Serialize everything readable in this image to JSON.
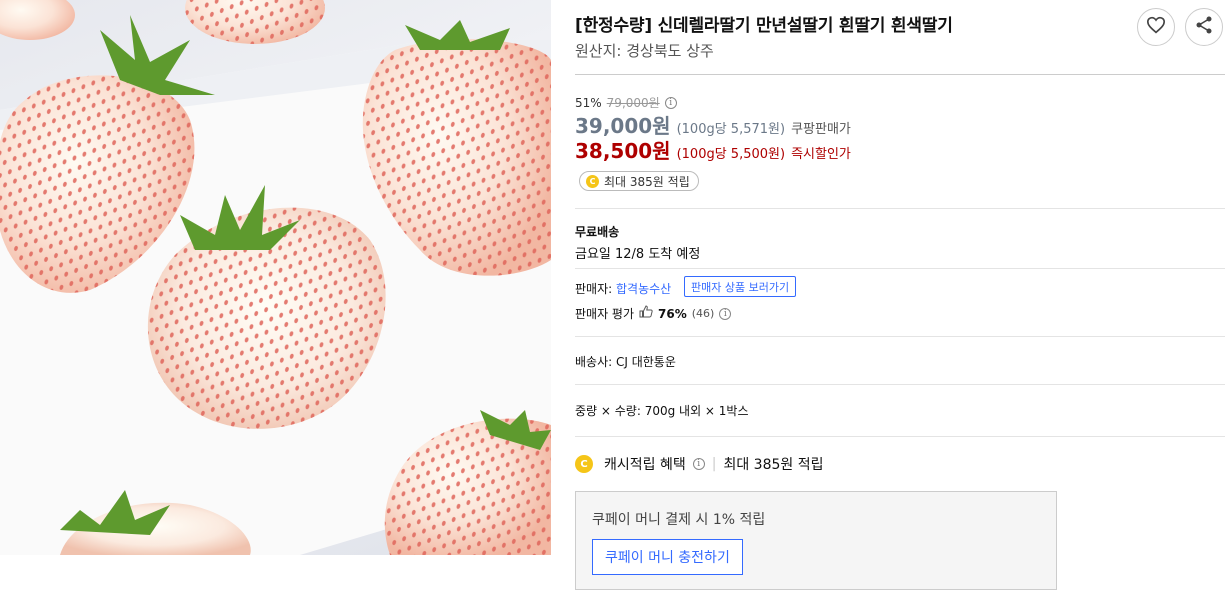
{
  "product": {
    "title": "[한정수량] 신데렐라딸기 만년설딸기 흰딸기 흰색딸기",
    "origin": "원산지: 경상북도 상주",
    "image_alt": "흰딸기"
  },
  "pricing": {
    "discount_rate": "51%",
    "original_price": "79,000원",
    "sale_price": "39,000원",
    "sale_unit": "(100g당 5,571원)",
    "sale_tag": "쿠팡판매가",
    "instant_price": "38,500원",
    "instant_unit": "(100g당 5,500원)",
    "instant_tag": "즉시할인가",
    "cash_pill": "최대 385원 적립"
  },
  "shipping": {
    "title": "무료배송",
    "arrival": "금요일 12/8 도착 예정"
  },
  "seller": {
    "label": "판매자:",
    "name": "합격농수산",
    "view_products": "판매자 상품 보러가기",
    "rating_label": "판매자 평가",
    "rating_percent": "76%",
    "rating_count": "(46)"
  },
  "carrier": "배송사: CJ 대한통운",
  "spec": "중량 × 수량: 700g 내외 × 1박스",
  "cash": {
    "label": "캐시적립 혜택",
    "value": "최대 385원 적립"
  },
  "coupay": {
    "message": "쿠페이 머니 결제 시 1% 적립",
    "button": "쿠페이 머니 충전하기"
  },
  "colors": {
    "accent": "#346aff",
    "price_red": "#ae0000",
    "price_gray": "#6b7888",
    "coin": "#f5c518"
  }
}
